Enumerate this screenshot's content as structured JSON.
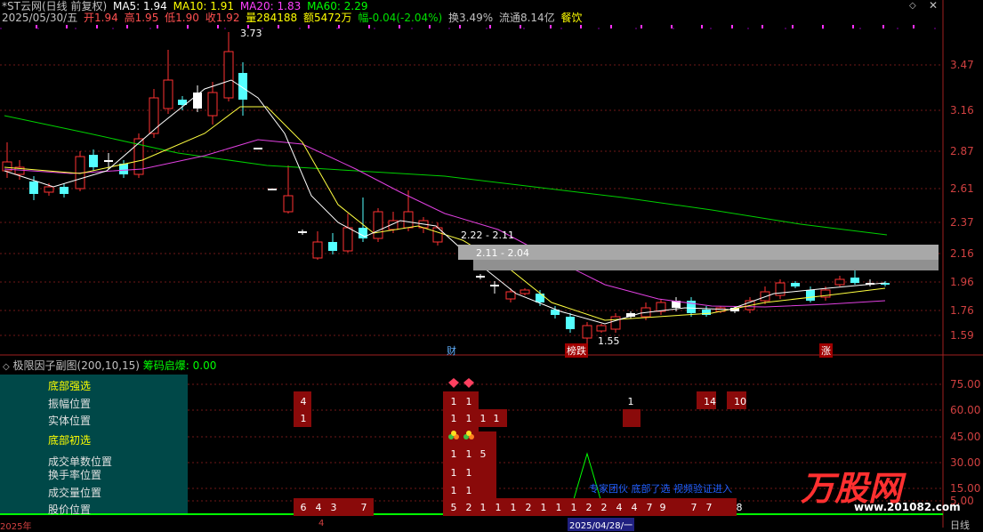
{
  "header": {
    "title": "*ST云网(日线 前复权)",
    "ma5": "MA5: 1.94",
    "ma10": "MA10: 1.91",
    "ma20": "MA20: 1.83",
    "ma60": "MA60: 2.29",
    "date": "2025/05/30/五",
    "open": "开1.94",
    "high": "高1.95",
    "low": "低1.90",
    "close": "收1.92",
    "volume": "量284188",
    "amount": "额5472万",
    "change": "幅-0.04(-2.04%)",
    "turnover": "换3.49%",
    "float": "流通8.14亿",
    "sector": "餐饮"
  },
  "price_axis": [
    "3.47",
    "3.16",
    "2.87",
    "2.61",
    "2.37",
    "2.16",
    "1.96",
    "1.76",
    "1.59"
  ],
  "annotations": {
    "high_marker": "3.73",
    "low_marker": "1.55",
    "band1": "2.22 - 2.11",
    "band2": "2.11 - 2.04",
    "tag_cai": "财",
    "tag_bangdie": "榜跌",
    "tag_zhang": "涨"
  },
  "indicator": {
    "title": "极限因子副图(200,10,15)",
    "chip": "筹码启爆: 0.00",
    "labels": [
      "底部强选",
      "振幅位置",
      "实体位置",
      "底部初选",
      "成交单数位置",
      "换手率位置",
      "成交量位置",
      "股价位置"
    ],
    "axis": [
      "75.00",
      "60.00",
      "45.00",
      "30.00",
      "15.00",
      "5.00"
    ],
    "row_zhenfu": [
      "4",
      "1",
      "1",
      "1",
      "14",
      "10"
    ],
    "row_shiti": [
      "1",
      "1",
      "1",
      "1",
      "1",
      "1"
    ],
    "row_danshu": [
      "1",
      "1",
      "5"
    ],
    "row_huanshou": [
      "1",
      "1"
    ],
    "row_liang": [
      "1",
      "1"
    ],
    "row_gujia": [
      "6",
      "4",
      "3",
      "7",
      "5",
      "2",
      "1",
      "1",
      "1",
      "2",
      "1",
      "1",
      "1",
      "2",
      "2",
      "4",
      "4",
      "7",
      "9",
      "7",
      "7",
      "8"
    ],
    "links": "专家团伙  底部了选  视频验证进入"
  },
  "time_axis": {
    "start": "2025年",
    "month": "4",
    "cursor": "2025/04/28/一",
    "period": "日线"
  },
  "watermark": "万股网",
  "watermark_url": "www.201082.com"
}
